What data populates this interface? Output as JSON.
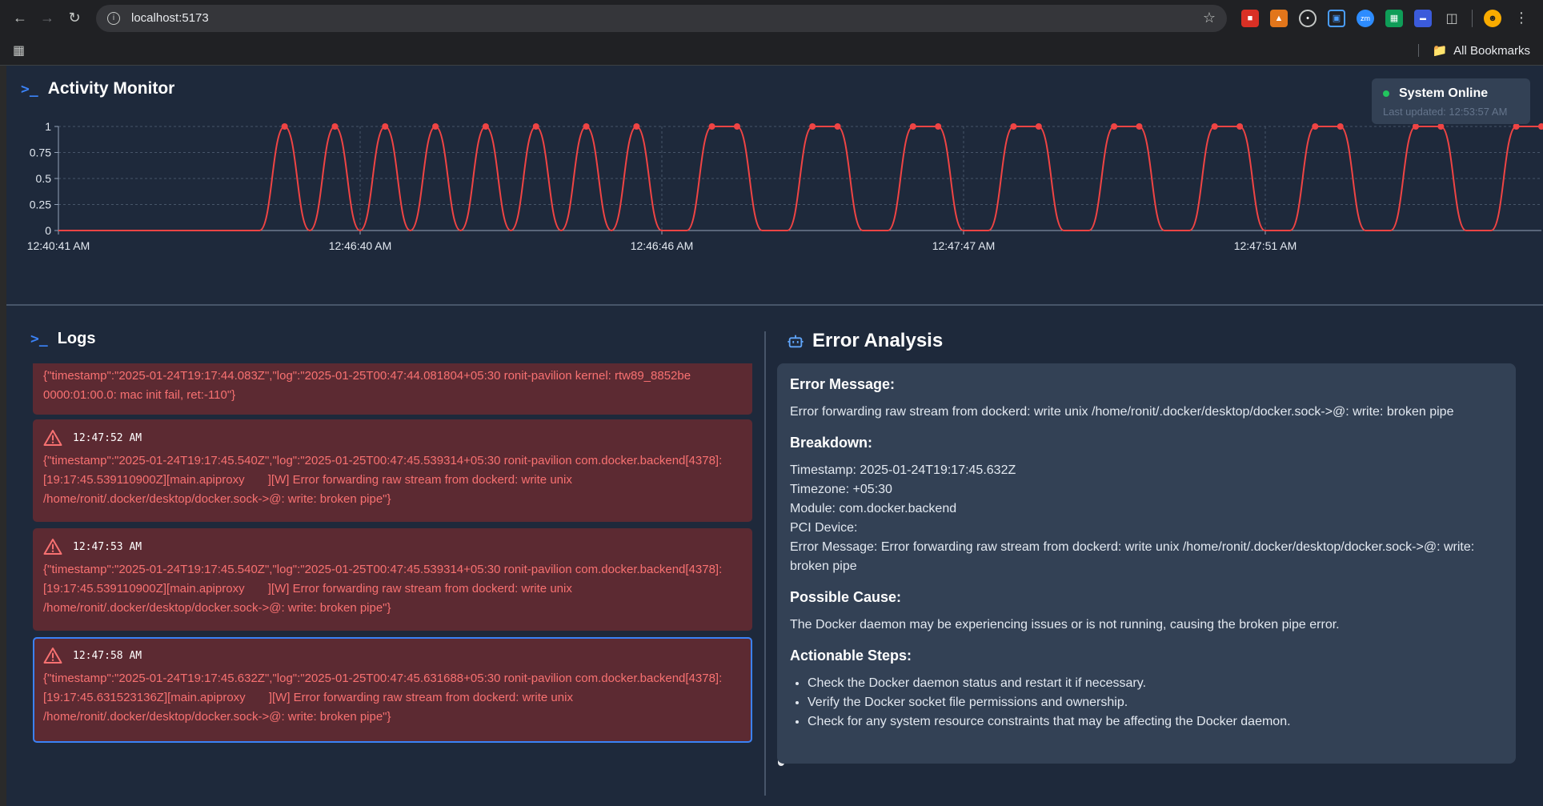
{
  "browser": {
    "url": "localhost:5173",
    "bookmarks_label": "All Bookmarks"
  },
  "header": {
    "title": "Activity Monitor",
    "status_label": "System Online",
    "last_updated": "Last updated: 12:53:57 AM"
  },
  "chart_data": {
    "type": "line",
    "title": "",
    "xlabel": "",
    "ylabel": "",
    "ylim": [
      0,
      1
    ],
    "yticks": [
      "0",
      "0.25",
      "0.5",
      "0.75",
      "1"
    ],
    "xtick_labels": [
      "12:40:41 AM",
      "12:46:40 AM",
      "12:46:46 AM",
      "12:47:47 AM",
      "12:47:51 AM"
    ],
    "series": [
      {
        "color": "#ef4444",
        "values": [
          0,
          0,
          0,
          0,
          0,
          0,
          0,
          0,
          0,
          1,
          0,
          1,
          0,
          1,
          0,
          1,
          0,
          1,
          0,
          1,
          0,
          1,
          0,
          1,
          0,
          0,
          1,
          1,
          0,
          0,
          1,
          1,
          0,
          0,
          1,
          1,
          0,
          0,
          1,
          1,
          0,
          0,
          1,
          1,
          0,
          0,
          1,
          1,
          0,
          0,
          1,
          1,
          0,
          0,
          1,
          1,
          0,
          0,
          1,
          1
        ]
      }
    ],
    "grid": true
  },
  "logs": {
    "title": "Logs",
    "entries": [
      {
        "time": "",
        "text": "{\"timestamp\":\"2025-01-24T19:17:44.083Z\",\"log\":\"2025-01-25T00:47:44.081804+05:30 ronit-pavilion kernel: rtw89_8852be 0000:01:00.0: mac init fail, ret:-110\"}"
      },
      {
        "time": "12:47:52 AM",
        "text": "{\"timestamp\":\"2025-01-24T19:17:45.540Z\",\"log\":\"2025-01-25T00:47:45.539314+05:30 ronit-pavilion com.docker.backend[4378]: [19:17:45.539110900Z][main.apiproxy       ][W] Error forwarding raw stream from dockerd: write unix /home/ronit/.docker/desktop/docker.sock->@: write: broken pipe\"}"
      },
      {
        "time": "12:47:53 AM",
        "text": "{\"timestamp\":\"2025-01-24T19:17:45.540Z\",\"log\":\"2025-01-25T00:47:45.539314+05:30 ronit-pavilion com.docker.backend[4378]: [19:17:45.539110900Z][main.apiproxy       ][W] Error forwarding raw stream from dockerd: write unix /home/ronit/.docker/desktop/docker.sock->@: write: broken pipe\"}"
      },
      {
        "time": "12:47:58 AM",
        "text": "{\"timestamp\":\"2025-01-24T19:17:45.632Z\",\"log\":\"2025-01-25T00:47:45.631688+05:30 ronit-pavilion com.docker.backend[4378]: [19:17:45.631523136Z][main.apiproxy       ][W] Error forwarding raw stream from dockerd: write unix /home/ronit/.docker/desktop/docker.sock->@: write: broken pipe\"}"
      }
    ]
  },
  "analysis": {
    "title": "Error Analysis",
    "error_message_head": "Error Message:",
    "error_message": "Error forwarding raw stream from dockerd: write unix /home/ronit/.docker/desktop/docker.sock->@: write: broken pipe",
    "breakdown_head": "Breakdown:",
    "breakdown": {
      "timestamp": "Timestamp: 2025-01-24T19:17:45.632Z",
      "timezone": "Timezone: +05:30",
      "module": "Module: com.docker.backend",
      "pci": "PCI Device:",
      "message": "Error Message: Error forwarding raw stream from dockerd: write unix /home/ronit/.docker/desktop/docker.sock->@: write: broken pipe"
    },
    "cause_head": "Possible Cause:",
    "cause": "The Docker daemon may be experiencing issues or is not running, causing the broken pipe error.",
    "steps_head": "Actionable Steps:",
    "steps": [
      "Check the Docker daemon status and restart it if necessary.",
      "Verify the Docker socket file permissions and ownership.",
      "Check for any system resource constraints that may be affecting the Docker daemon."
    ]
  }
}
